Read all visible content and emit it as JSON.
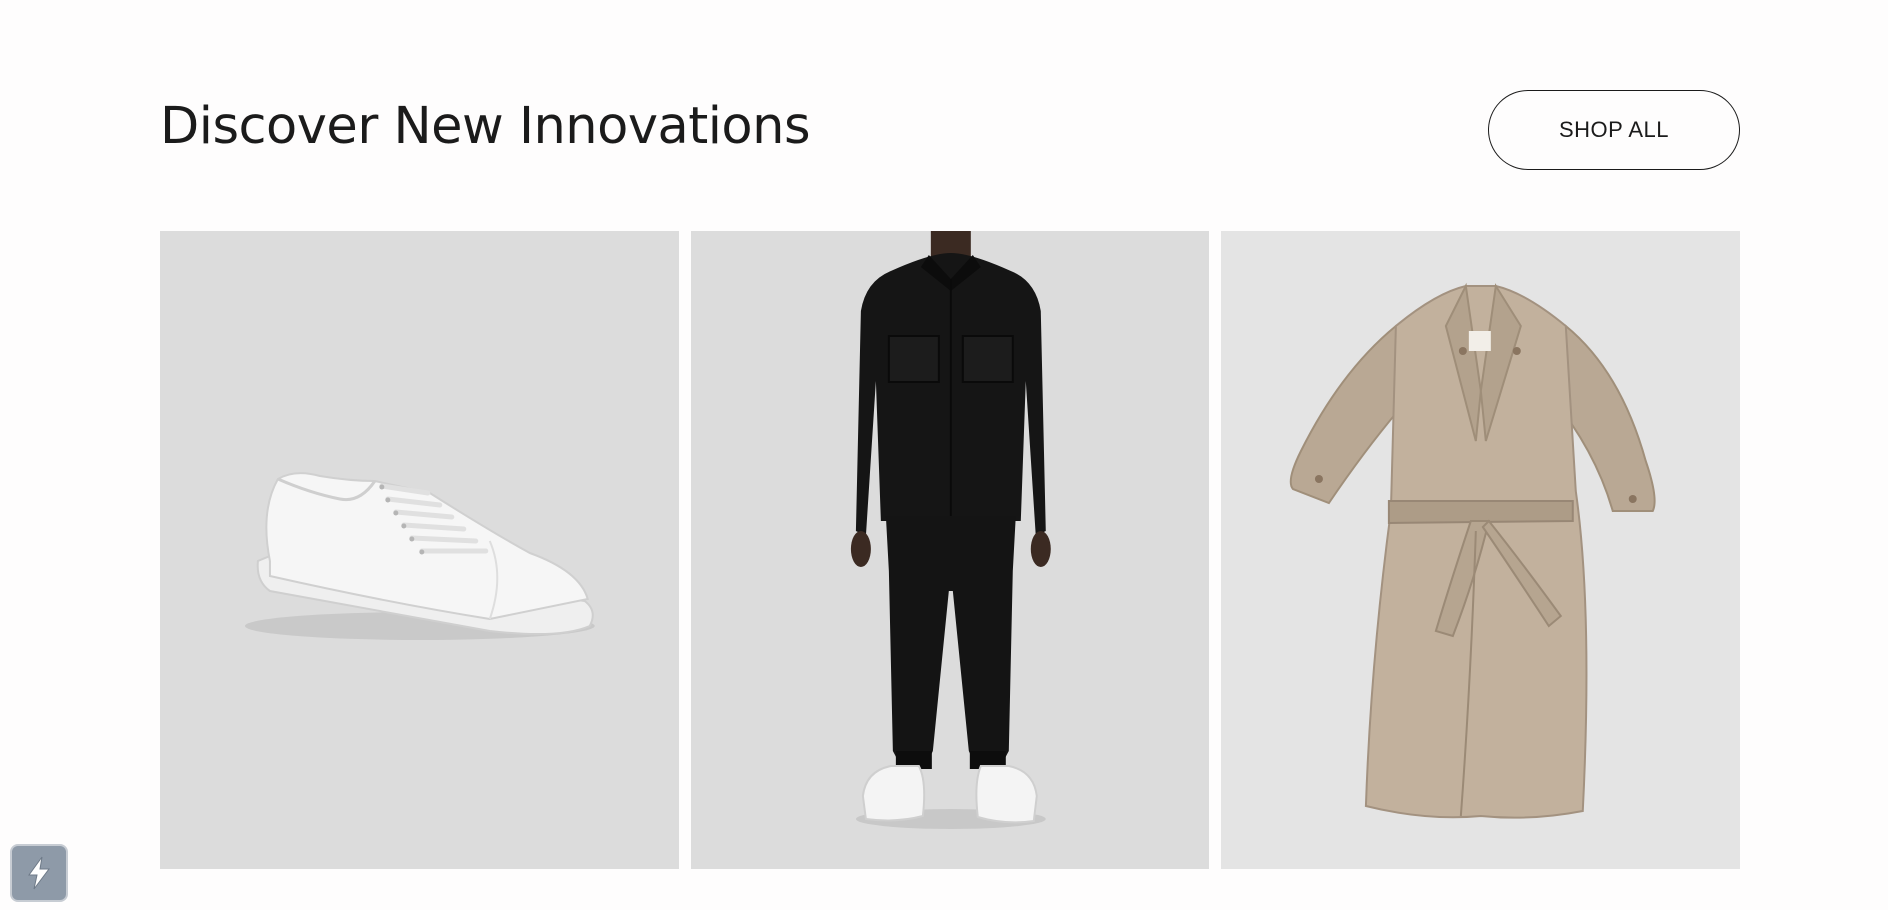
{
  "section": {
    "title": "Discover New Innovations",
    "shop_all_label": "SHOP ALL"
  },
  "products": [
    {
      "name": "sneaker-image",
      "icon": "white-sneaker"
    },
    {
      "name": "menswear-image",
      "icon": "black-shirt-and-joggers-outfit"
    },
    {
      "name": "trench-coat-image",
      "icon": "beige-trench-coat"
    }
  ],
  "widget": {
    "icon": "lightning-bolt-icon"
  },
  "colors": {
    "background": "#fefdfd",
    "tile_background": "#dcdcdc",
    "text": "#1b1b1b"
  }
}
